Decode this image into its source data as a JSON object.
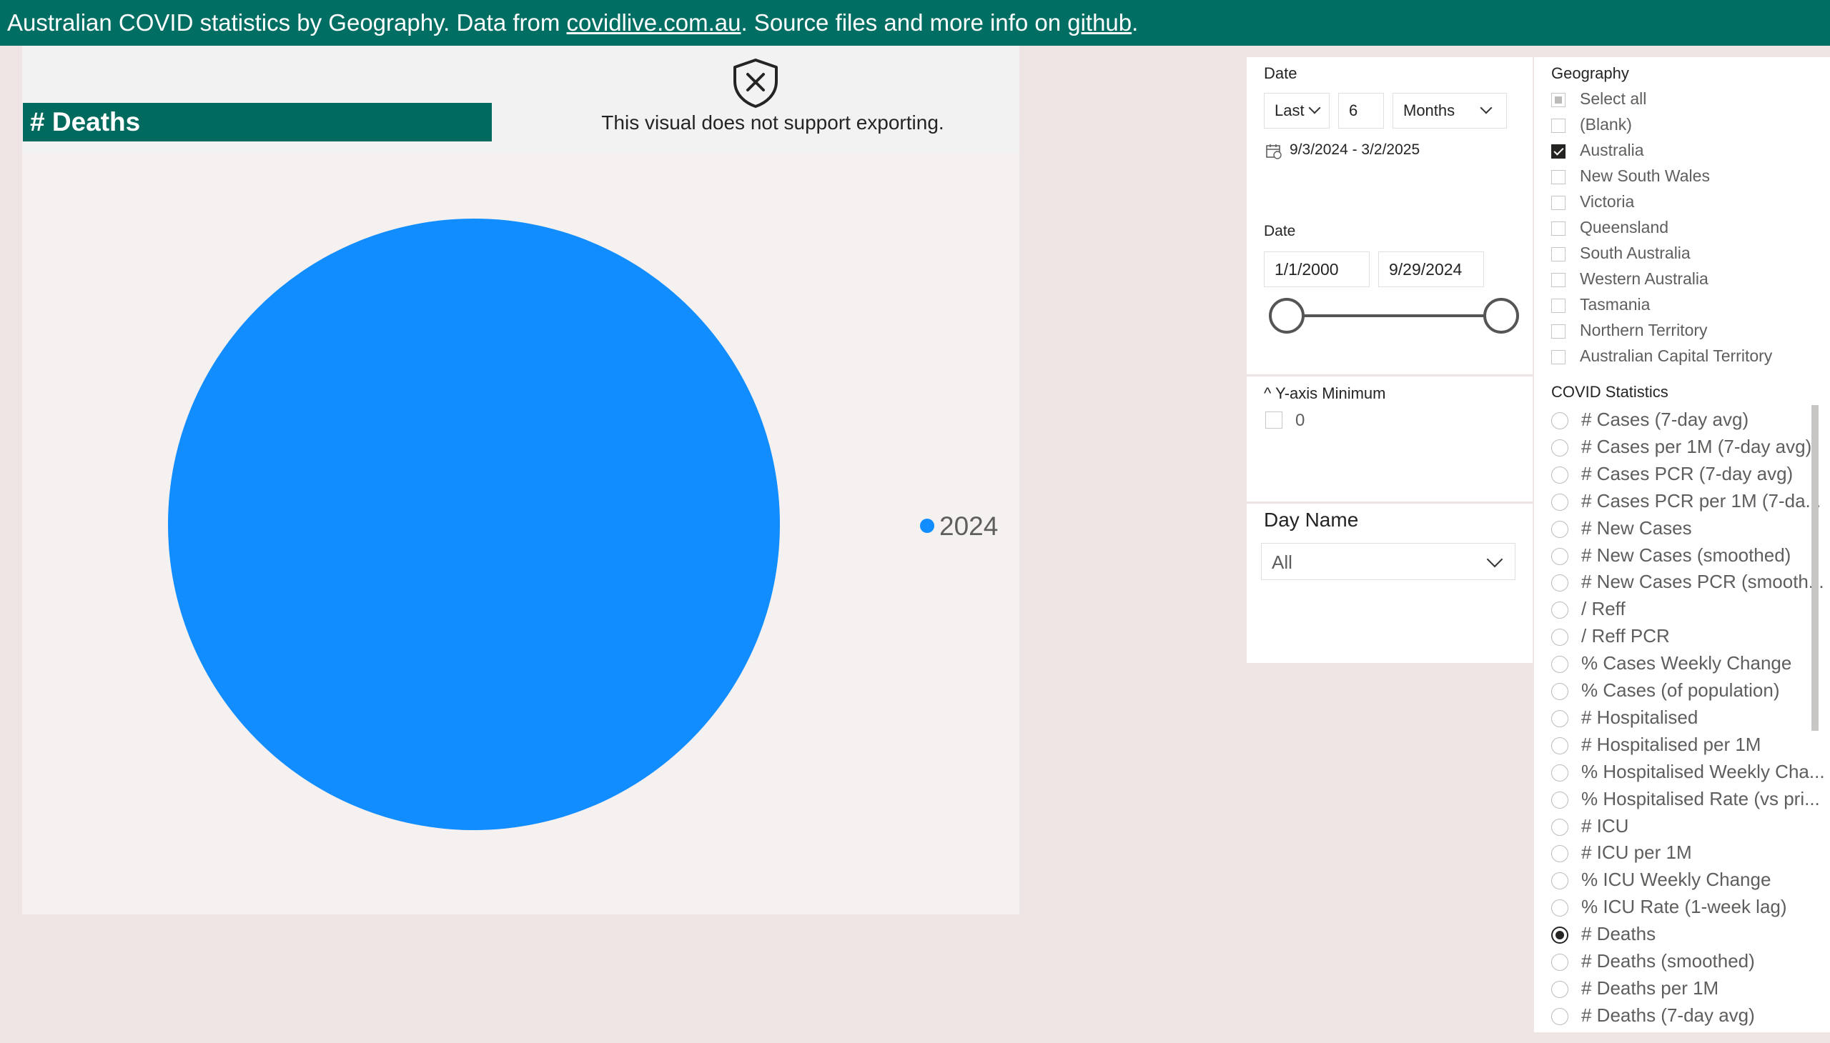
{
  "header": {
    "prefix": "Australian COVID statistics by Geography. Data from ",
    "link1": "covidlive.com.au",
    "middle": ". Source files and more info on ",
    "link2": "github",
    "suffix": "."
  },
  "visual": {
    "title": "# Deaths",
    "export_message": "This visual does not support exporting.",
    "export_icon": "shield-x-icon"
  },
  "chart_data": {
    "type": "pie",
    "title": "# Deaths",
    "slices": [
      {
        "label": "2024",
        "fraction": 1.0,
        "color": "#118dff"
      }
    ],
    "legend": [
      "2024"
    ],
    "legend_position": "right"
  },
  "relative_date_filter": {
    "label": "Date",
    "mode": "Last",
    "count": "6",
    "unit": "Months",
    "range_text": "9/3/2024 - 3/2/2025",
    "calendar_icon": "calendar-icon"
  },
  "date_range_filter": {
    "label": "Date",
    "start": "1/1/2000",
    "end": "9/29/2024",
    "start_level": 0.0,
    "end_level": 1.0
  },
  "y_axis_filter": {
    "label": "^ Y-axis Minimum",
    "option": "0"
  },
  "day_name_filter": {
    "label": "Day Name",
    "value": "All"
  },
  "geography": {
    "label": "Geography",
    "items": [
      {
        "label": "Select all",
        "state": "partial"
      },
      {
        "label": "(Blank)",
        "state": "unchecked"
      },
      {
        "label": "Australia",
        "state": "checked"
      },
      {
        "label": "New South Wales",
        "state": "unchecked"
      },
      {
        "label": "Victoria",
        "state": "unchecked"
      },
      {
        "label": "Queensland",
        "state": "unchecked"
      },
      {
        "label": "South Australia",
        "state": "unchecked"
      },
      {
        "label": "Western Australia",
        "state": "unchecked"
      },
      {
        "label": "Tasmania",
        "state": "unchecked"
      },
      {
        "label": "Northern Territory",
        "state": "unchecked"
      },
      {
        "label": "Australian Capital Territory",
        "state": "unchecked"
      }
    ]
  },
  "covid_statistics": {
    "label": "COVID Statistics",
    "items": [
      {
        "label": "# Cases (7-day avg)",
        "selected": false
      },
      {
        "label": "# Cases per 1M (7-day avg)",
        "selected": false
      },
      {
        "label": "# Cases PCR (7-day avg)",
        "selected": false
      },
      {
        "label": "# Cases PCR per 1M (7-da...",
        "selected": false
      },
      {
        "label": "# New Cases",
        "selected": false
      },
      {
        "label": "# New Cases (smoothed)",
        "selected": false
      },
      {
        "label": "# New Cases PCR (smooth...",
        "selected": false
      },
      {
        "label": "/ Reff",
        "selected": false
      },
      {
        "label": "/ Reff PCR",
        "selected": false
      },
      {
        "label": "% Cases Weekly Change",
        "selected": false
      },
      {
        "label": "% Cases (of population)",
        "selected": false
      },
      {
        "label": "# Hospitalised",
        "selected": false
      },
      {
        "label": "# Hospitalised per 1M",
        "selected": false
      },
      {
        "label": "% Hospitalised Weekly Cha...",
        "selected": false
      },
      {
        "label": "% Hospitalised Rate (vs pri...",
        "selected": false
      },
      {
        "label": "# ICU",
        "selected": false
      },
      {
        "label": "# ICU per 1M",
        "selected": false
      },
      {
        "label": "% ICU Weekly Change",
        "selected": false
      },
      {
        "label": "% ICU Rate (1-week lag)",
        "selected": false
      },
      {
        "label": "# Deaths",
        "selected": true
      },
      {
        "label": "# Deaths (smoothed)",
        "selected": false
      },
      {
        "label": "# Deaths per 1M",
        "selected": false
      },
      {
        "label": "# Deaths (7-day avg)",
        "selected": false
      }
    ]
  }
}
